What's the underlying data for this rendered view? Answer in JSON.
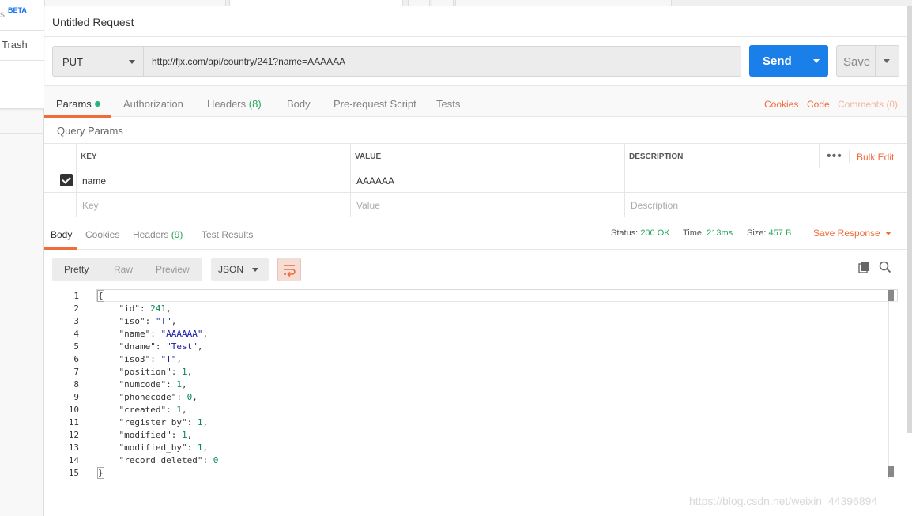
{
  "sidebar": {
    "s_fragment": "s",
    "beta_badge": "BETA",
    "trash_label": "Trash"
  },
  "request": {
    "title": "Untitled Request",
    "method": "PUT",
    "url": "http://fjx.com/api/country/241?name=AAAAAA",
    "send_label": "Send",
    "save_label": "Save"
  },
  "request_tabs": {
    "params": "Params",
    "authorization": "Authorization",
    "headers": "Headers",
    "headers_count": "(8)",
    "body": "Body",
    "prerequest": "Pre-request Script",
    "tests": "Tests",
    "cookies": "Cookies",
    "code": "Code",
    "comments": "Comments (0)"
  },
  "query_params": {
    "title": "Query Params",
    "columns": [
      "KEY",
      "VALUE",
      "DESCRIPTION"
    ],
    "bulk_edit": "Bulk Edit",
    "rows": [
      {
        "checked": true,
        "key": "name",
        "value": "AAAAAA",
        "description": ""
      }
    ],
    "placeholders": {
      "key": "Key",
      "value": "Value",
      "description": "Description"
    }
  },
  "response_tabs": {
    "body": "Body",
    "cookies": "Cookies",
    "headers": "Headers",
    "headers_count": "(9)",
    "test_results": "Test Results"
  },
  "response_status": {
    "status_label": "Status:",
    "status_value": "200 OK",
    "time_label": "Time:",
    "time_value": "213ms",
    "size_label": "Size:",
    "size_value": "457 B",
    "save_response": "Save Response"
  },
  "view": {
    "pretty": "Pretty",
    "raw": "Raw",
    "preview": "Preview",
    "format": "JSON"
  },
  "code_lines": [
    "{",
    "    \"id\": 241,",
    "    \"iso\": \"T\",",
    "    \"name\": \"AAAAAA\",",
    "    \"dname\": \"Test\",",
    "    \"iso3\": \"T\",",
    "    \"position\": 1,",
    "    \"numcode\": 1,",
    "    \"phonecode\": 0,",
    "    \"created\": 1,",
    "    \"register_by\": 1,",
    "    \"modified\": 1,",
    "    \"modified_by\": 1,",
    "    \"record_deleted\": 0",
    "}"
  ],
  "watermark": "https://blog.csdn.net/weixin_44396894",
  "colors": {
    "accent": "#f26b3a",
    "send": "#1b7fea",
    "status_ok": "#26a65b"
  }
}
